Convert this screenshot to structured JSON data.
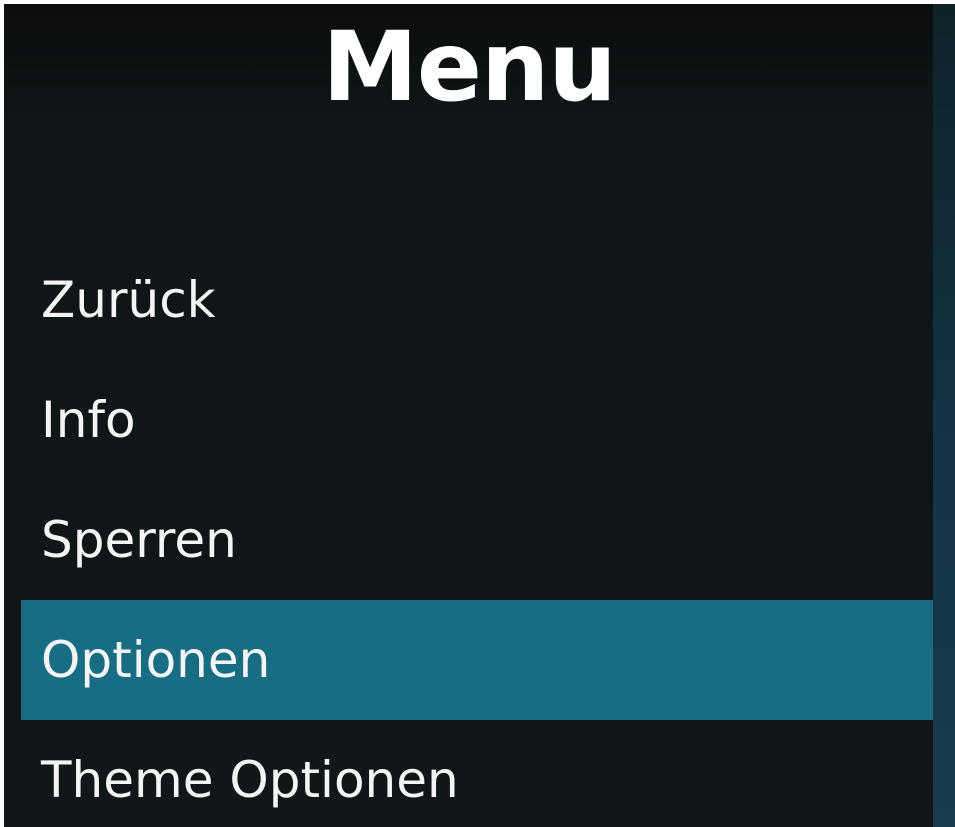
{
  "header": {
    "title": "Menu"
  },
  "menu": {
    "selected_index": 3,
    "items": [
      {
        "label": "Zurück"
      },
      {
        "label": "Info"
      },
      {
        "label": "Sperren"
      },
      {
        "label": "Optionen"
      },
      {
        "label": "Theme Optionen"
      }
    ]
  },
  "colors": {
    "background": "#111719",
    "highlight": "#196d83",
    "text": "#f2f4f5",
    "side_strip": "#173d4e"
  }
}
